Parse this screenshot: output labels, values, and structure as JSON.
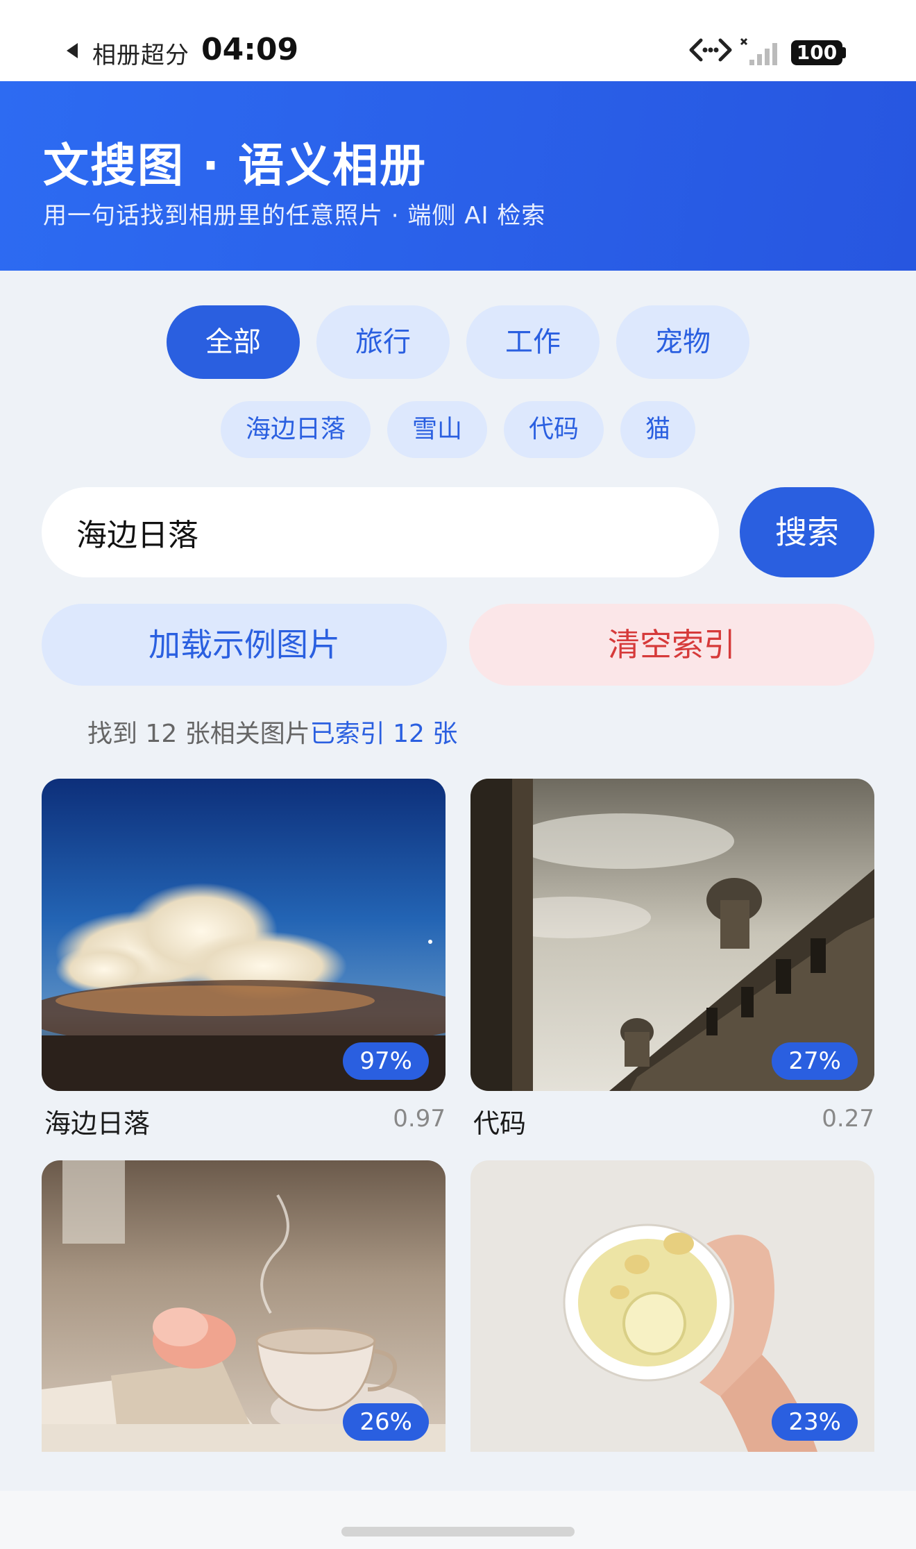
{
  "status_bar": {
    "app_name": "相册超分",
    "time": "04:09",
    "battery": "100",
    "icons": [
      "back-triangle-icon",
      "link-icon",
      "signal-icon",
      "battery-icon"
    ]
  },
  "header": {
    "title": "文搜图 · 语义相册",
    "subtitle": "用一句话找到相册里的任意照片 · 端侧 AI 检索",
    "background_color": "#2d6bf2"
  },
  "categories": [
    "全部",
    "旅行",
    "工作",
    "宠物"
  ],
  "active_category": "全部",
  "suggestions": [
    "海边日落",
    "雪山",
    "代码",
    "猫"
  ],
  "search": {
    "value": "海边日落",
    "button_label": "搜索"
  },
  "actions": {
    "load_label": "加载示例图片",
    "clear_label": "清空索引"
  },
  "result": {
    "found": "找到 12 张相关图片",
    "indexed": "已索引 12 张"
  },
  "photos": [
    {
      "caption": "海边日落",
      "score": "0.97",
      "badge": "97%",
      "image": "sky-clouds-photo"
    },
    {
      "caption": "代码",
      "score": "0.27",
      "badge": "27%",
      "image": "building-photo"
    },
    {
      "caption": "",
      "score": "",
      "badge": "26%",
      "image": "teacup-book-photo"
    },
    {
      "caption": "",
      "score": "",
      "badge": "23%",
      "image": "lemon-tea-photo"
    }
  ],
  "colors": {
    "accent": "#2a5fe0",
    "chip_bg": "#dde8fd",
    "danger": "#d63a3a",
    "danger_bg": "#fbe6e8",
    "page_bg": "#eef2f7"
  }
}
